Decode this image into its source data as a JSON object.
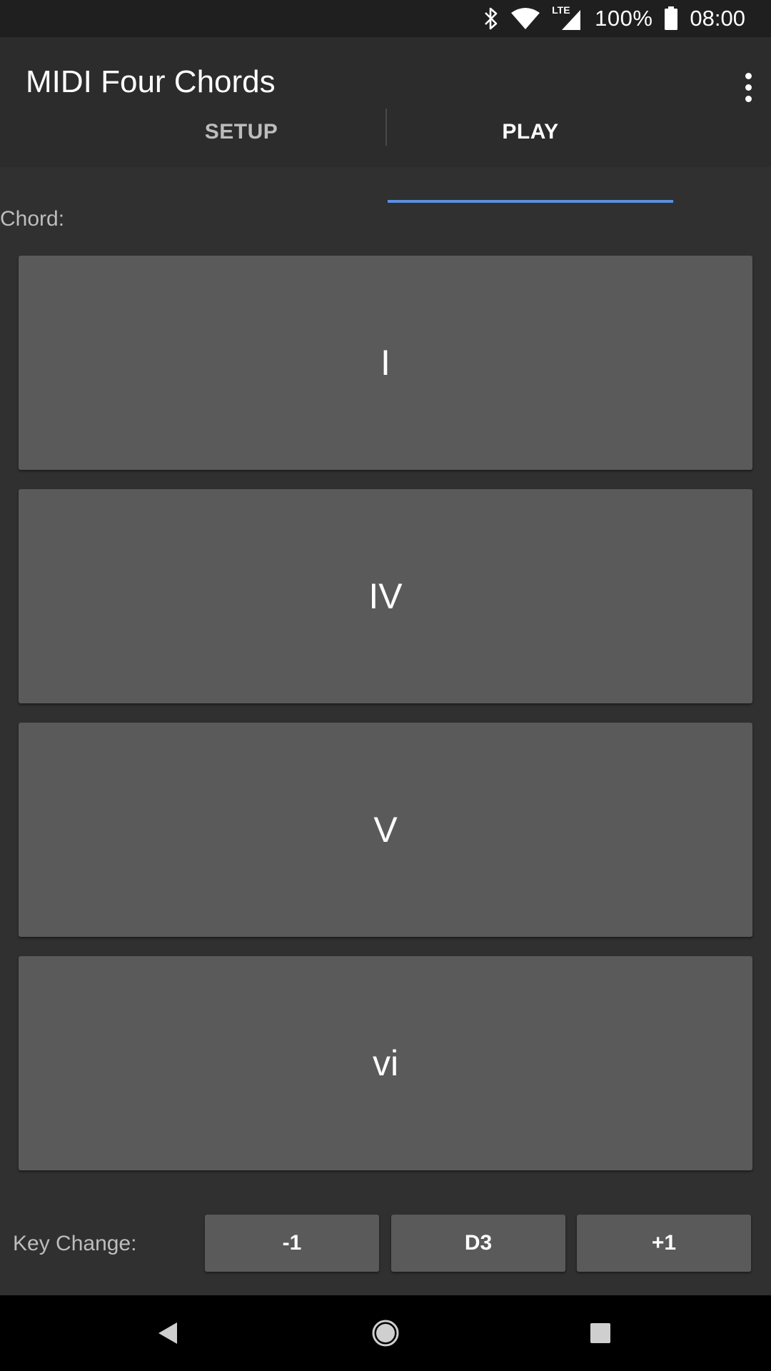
{
  "status_bar": {
    "network_label": "LTE",
    "battery_text": "100%",
    "time": "08:00"
  },
  "app_bar": {
    "title": "MIDI Four Chords",
    "menu_icon": "more-vert-icon"
  },
  "tabs": [
    {
      "label": "SETUP",
      "selected": false
    },
    {
      "label": "PLAY",
      "selected": true
    }
  ],
  "play": {
    "chord_label": "Chord:",
    "chords": [
      {
        "label": "I"
      },
      {
        "label": "IV"
      },
      {
        "label": "V"
      },
      {
        "label": "vi"
      }
    ],
    "key_change_label": "Key Change:",
    "key_minus": "-1",
    "key_current": "D3",
    "key_plus": "+1"
  },
  "colors": {
    "background": "#303030",
    "app_bar": "#2c2c2c",
    "status_bar": "#1f1f1f",
    "button": "#5a5a5b",
    "tab_indicator": "#5c8fe0",
    "nav_bar": "#000000"
  }
}
